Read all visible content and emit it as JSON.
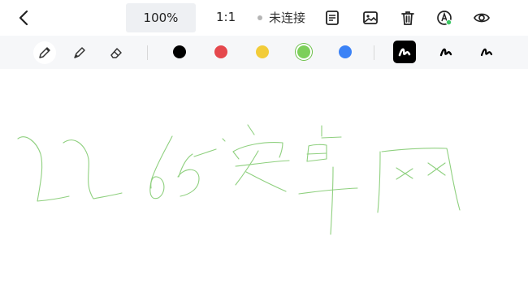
{
  "header": {
    "zoom": "100%",
    "ratio": "1:1",
    "connection_status": "未连接",
    "icons": [
      "back-chevron-icon",
      "notebook-icon",
      "image-icon",
      "trash-icon",
      "pen-connect-icon",
      "eye-icon"
    ]
  },
  "toolbar": {
    "tools": [
      "pencil-icon",
      "marker-icon",
      "eraser-icon"
    ],
    "active_tool": "pencil-icon",
    "colors": [
      "#000000",
      "#e5484d",
      "#f2cc39",
      "#7ccf59",
      "#3b82f6"
    ],
    "selected_color": "#7ccf59",
    "stroke_styles": [
      "stroke-bold",
      "stroke-medium",
      "stroke-thin"
    ],
    "selected_stroke": "stroke-bold"
  },
  "canvas": {
    "ink_color": "#8fd07f"
  }
}
